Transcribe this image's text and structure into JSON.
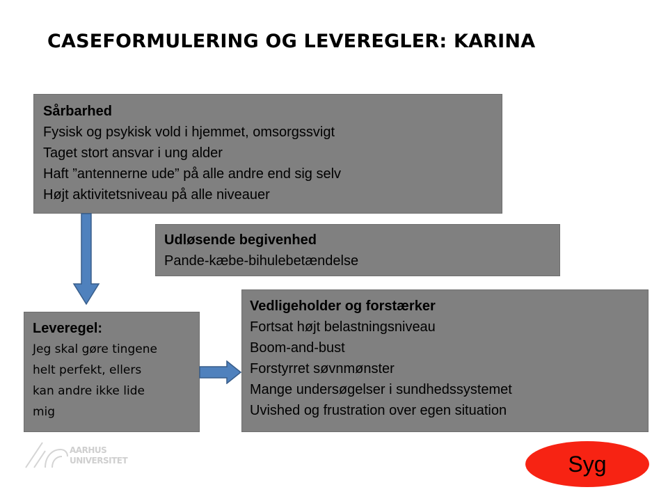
{
  "title": "CASEFORMULERING OG LEVEREGLER: KARINA",
  "vulnerability": {
    "heading": "Sårbarhed",
    "lines": [
      "Fysisk og psykisk vold i hjemmet, omsorgssvigt",
      "Taget stort ansvar i ung alder",
      "Haft ”antennerne ude” på alle andre end sig selv",
      "Højt aktivitetsniveau på alle niveauer"
    ]
  },
  "trigger": {
    "heading": "Udløsende begivenhed",
    "lines": [
      "Pande-kæbe-bihulebetændelse"
    ]
  },
  "life_rule": {
    "heading": "Leveregel:",
    "lines": [
      "Jeg skal gøre tingene",
      "helt perfekt, ellers",
      "kan andre ikke lide",
      "mig"
    ]
  },
  "maintaining": {
    "heading": "Vedligeholder og forstærker",
    "lines": [
      "Fortsat højt belastningsniveau",
      "Boom-and-bust",
      "Forstyrret søvnmønster",
      "Mange undersøgelser i sundhedssystemet",
      "Uvished og frustration over egen situation"
    ]
  },
  "logo": {
    "line1": "AARHUS",
    "line2": "UNIVERSITET"
  },
  "badge": {
    "label": "Syg"
  },
  "colors": {
    "box_fill": "#808080",
    "arrow_fill": "#4f81bd",
    "arrow_stroke": "#385d8a",
    "badge_fill": "#f72313"
  }
}
